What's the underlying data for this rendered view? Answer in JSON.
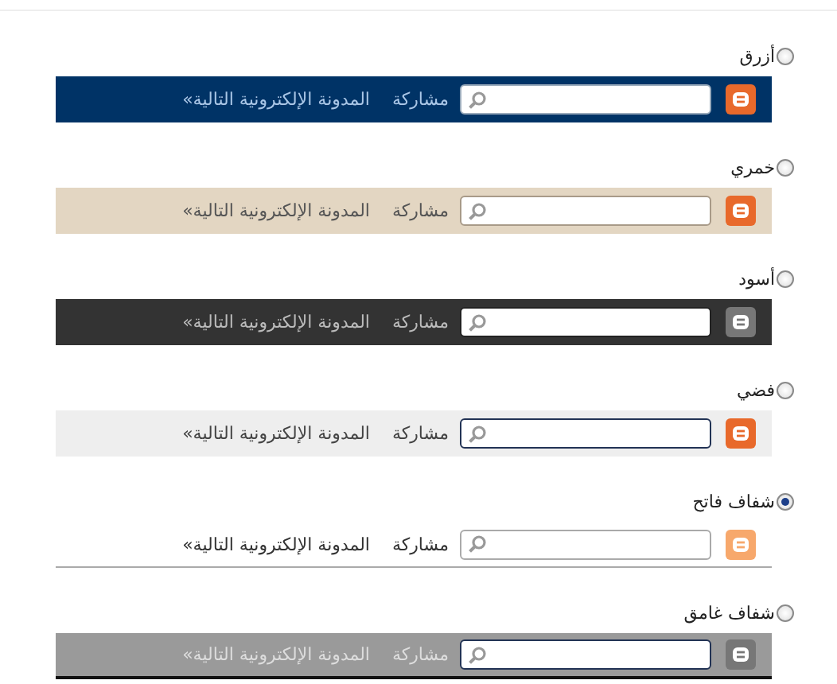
{
  "options": [
    {
      "label": "أزرق",
      "selected": false,
      "kind": "blue",
      "share": "مشاركة",
      "next": "المدونة الإلكترونية التالية»"
    },
    {
      "label": "خمري",
      "selected": false,
      "kind": "tan",
      "share": "مشاركة",
      "next": "المدونة الإلكترونية التالية»"
    },
    {
      "label": "أسود",
      "selected": false,
      "kind": "black",
      "share": "مشاركة",
      "next": "المدونة الإلكترونية التالية»"
    },
    {
      "label": "فضي",
      "selected": false,
      "kind": "silver",
      "share": "مشاركة",
      "next": "المدونة الإلكترونية التالية»"
    },
    {
      "label": "شفاف فاتح",
      "selected": true,
      "kind": "light",
      "share": "مشاركة",
      "next": "المدونة الإلكترونية التالية»"
    },
    {
      "label": "شفاف غامق",
      "selected": false,
      "kind": "dark",
      "share": "مشاركة",
      "next": "المدونة الإلكترونية التالية»"
    }
  ]
}
